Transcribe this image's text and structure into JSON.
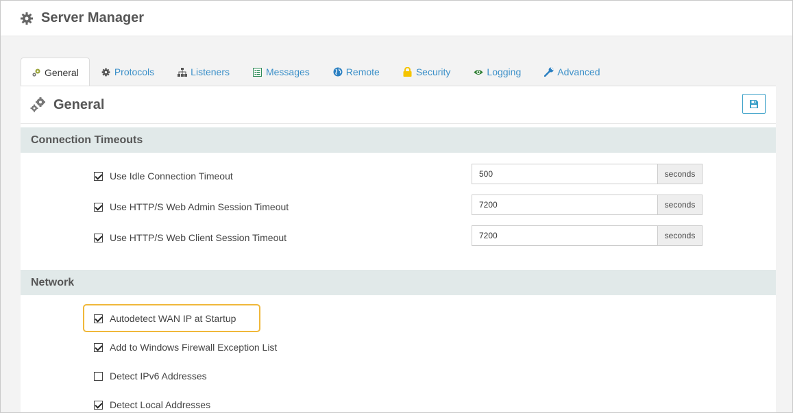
{
  "app": {
    "title": "Server Manager",
    "icon": "gear-icon"
  },
  "tabs": [
    {
      "label": "General",
      "icon": "cogs-icon",
      "active": true
    },
    {
      "label": "Protocols",
      "icon": "gear-icon"
    },
    {
      "label": "Listeners",
      "icon": "sitemap-icon"
    },
    {
      "label": "Messages",
      "icon": "list-icon"
    },
    {
      "label": "Remote",
      "icon": "globe-icon"
    },
    {
      "label": "Security",
      "icon": "lock-icon"
    },
    {
      "label": "Logging",
      "icon": "eye-icon"
    },
    {
      "label": "Advanced",
      "icon": "wrench-icon"
    }
  ],
  "panel": {
    "title": "General",
    "save_icon": "save-icon"
  },
  "sections": {
    "timeouts": {
      "title": "Connection Timeouts",
      "items": [
        {
          "label": "Use Idle Connection Timeout",
          "checked": true,
          "value": "500",
          "unit": "seconds"
        },
        {
          "label": "Use HTTP/S Web Admin Session Timeout",
          "checked": true,
          "value": "7200",
          "unit": "seconds"
        },
        {
          "label": "Use HTTP/S Web Client Session Timeout",
          "checked": true,
          "value": "7200",
          "unit": "seconds"
        }
      ]
    },
    "network": {
      "title": "Network",
      "items": [
        {
          "label": "Autodetect WAN IP at Startup",
          "checked": true
        },
        {
          "label": "Add to Windows Firewall Exception List",
          "checked": true
        },
        {
          "label": "Detect IPv6 Addresses",
          "checked": false
        },
        {
          "label": "Detect Local Addresses",
          "checked": true
        }
      ]
    }
  },
  "colors": {
    "accent": "#3a8fc8",
    "section_bg": "#e1e9e9",
    "highlight": "#f0b83a",
    "lock": "#f5c400",
    "eye": "#2e7d32",
    "messages": "#2e8b57"
  }
}
